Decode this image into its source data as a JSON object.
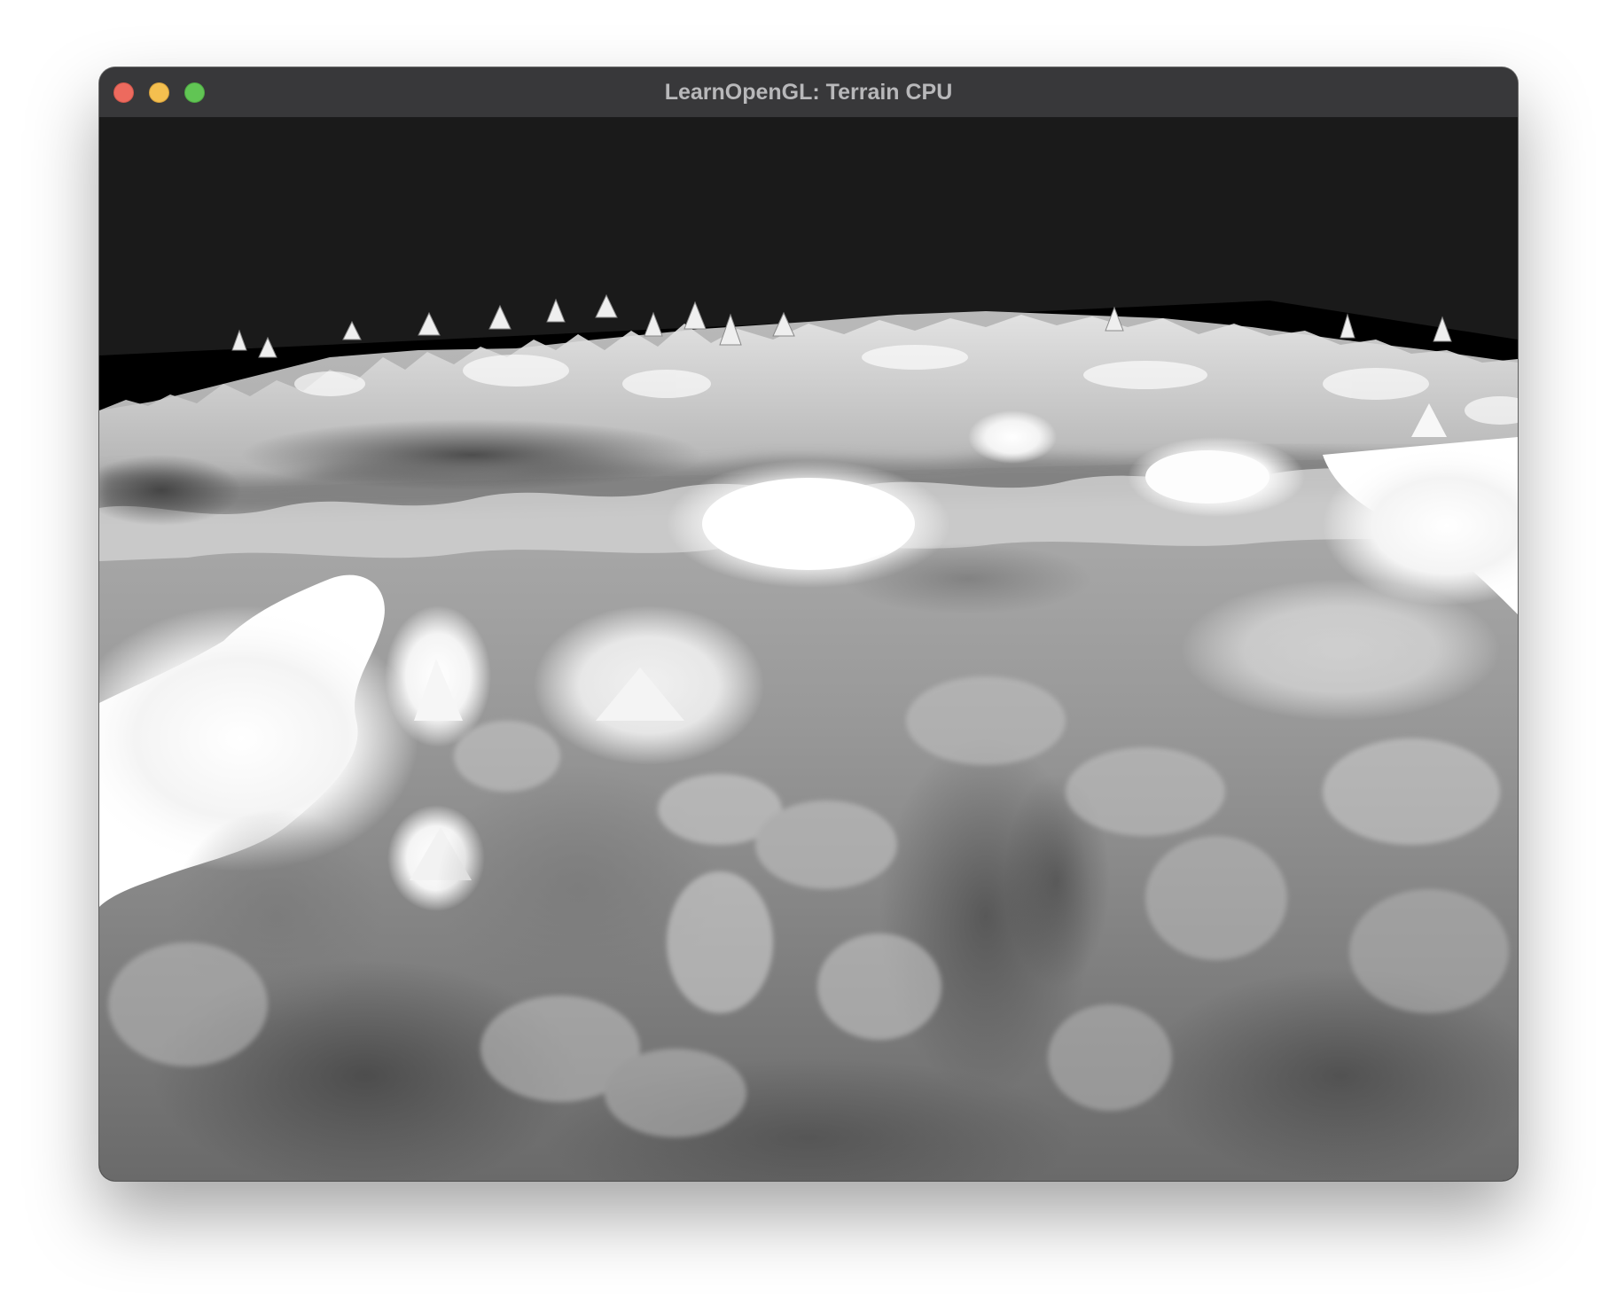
{
  "window": {
    "title": "LearnOpenGL: Terrain CPU"
  },
  "viewport": {
    "content": "rendered-terrain-heightmap",
    "clear_color": "#1a1a1a",
    "shading": "grayscale"
  },
  "colors": {
    "close": "#ed6a5e",
    "minimize": "#f4bf4f",
    "zoom": "#61c554",
    "titlebar": "#38383a"
  }
}
